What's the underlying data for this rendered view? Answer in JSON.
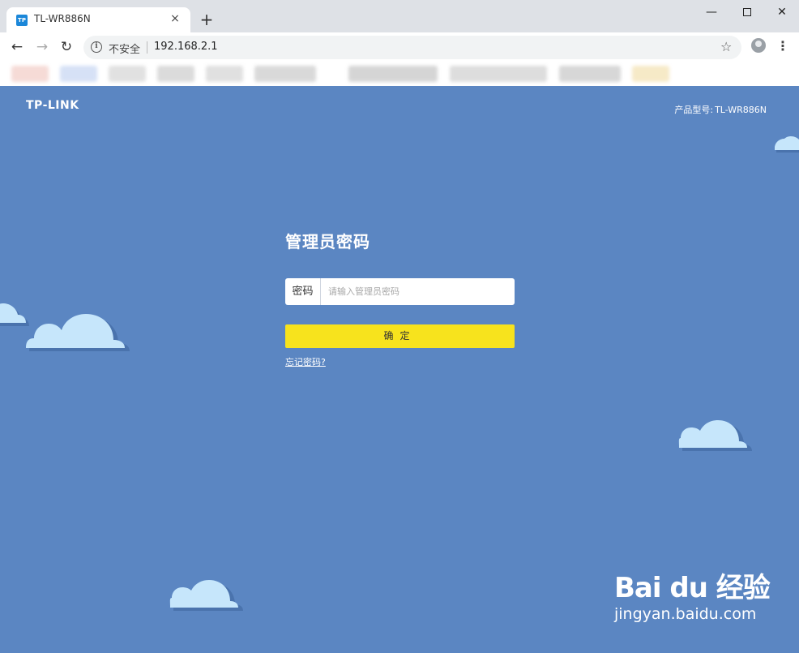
{
  "browser": {
    "tab_title": "TL-WR886N",
    "tab_favicon_text": "TP",
    "tab_close": "×",
    "new_tab": "+",
    "window_minimize": "—",
    "window_close": "✕",
    "nav_back": "←",
    "nav_forward": "→",
    "nav_reload": "↻",
    "security_label": "不安全",
    "url": "192.168.2.1",
    "star": "☆",
    "menu": "⋮"
  },
  "router": {
    "logo": "TP-LINK",
    "model_label": "产品型号:",
    "model_value": "TL-WR886N",
    "login_title": "管理员密码",
    "password_label": "密码",
    "password_placeholder": "请输入管理员密码",
    "confirm_button": "确定",
    "forgot_password": "忘记密码?"
  },
  "watermark": {
    "brand": "Bai du 经验",
    "url": "jingyan.baidu.com"
  },
  "colors": {
    "page_background": "#5b86c2",
    "confirm_button": "#f7e31d",
    "cloud": "#c6e6fb",
    "cloud_shadow": "#4a73ad"
  }
}
